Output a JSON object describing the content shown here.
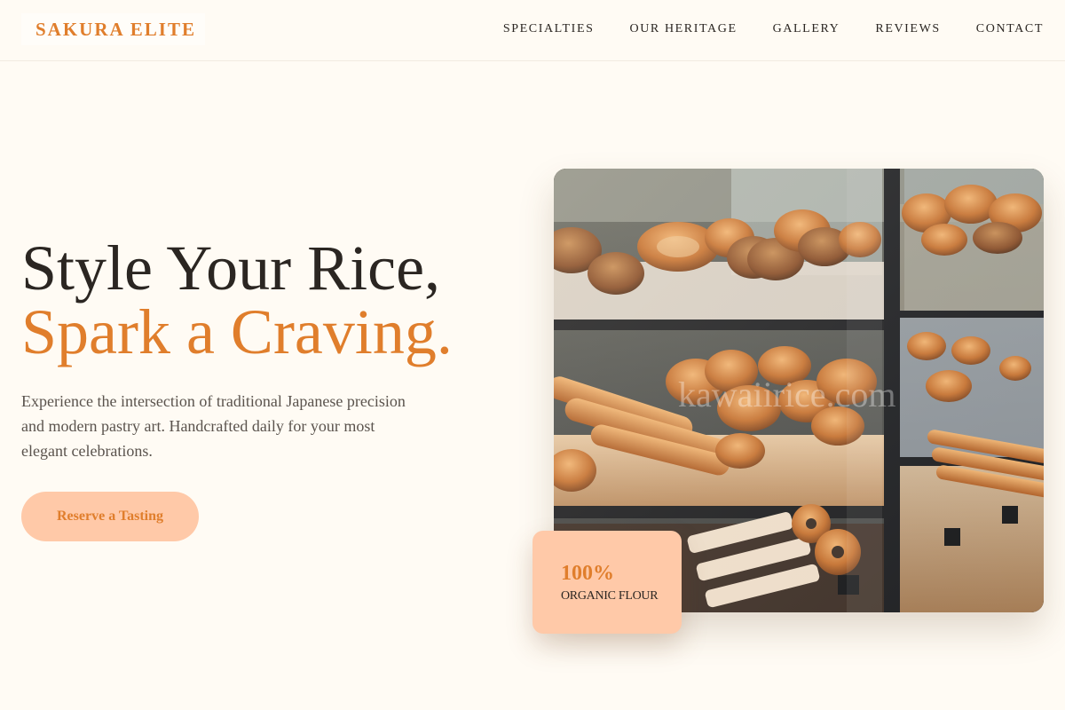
{
  "brand": {
    "name": "SAKURA ELITE"
  },
  "nav": {
    "items": [
      {
        "label": "SPECIALTIES"
      },
      {
        "label": "OUR HERITAGE"
      },
      {
        "label": "GALLERY"
      },
      {
        "label": "REVIEWS"
      },
      {
        "label": "CONTACT"
      }
    ]
  },
  "hero": {
    "title_line1": "Style Your Rice,",
    "title_line2": "Spark a Craving.",
    "description": "Experience the intersection of traditional Japanese precision and modern pastry art. Handcrafted daily for your most elegant celebrations.",
    "cta_label": "Reserve a Tasting",
    "image": {
      "subject": "bakery-display-case-with-breads",
      "watermark": "kawaiirice.com"
    }
  },
  "stat": {
    "value": "100%",
    "label": "ORGANIC FLOUR"
  },
  "colors": {
    "accent": "#e07e2c",
    "accent_soft": "#ffc9a8",
    "background": "#fffbf4",
    "text": "#2b2622",
    "muted_text": "#5a534d"
  }
}
